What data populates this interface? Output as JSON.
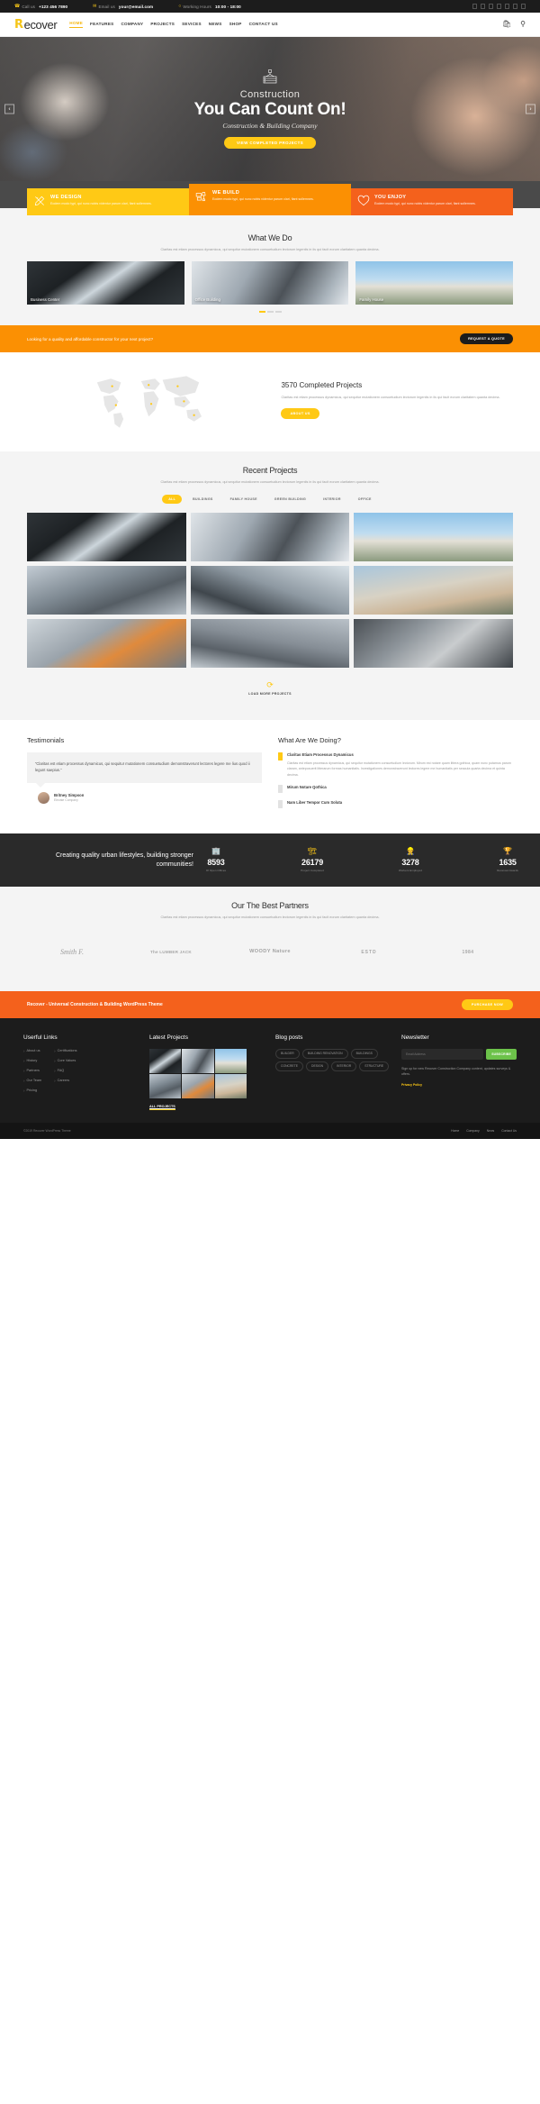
{
  "topbar": {
    "phone_label": "Call us",
    "phone_value": "+123 456 7890",
    "email_label": "Email us",
    "email_value": "your@email.com",
    "hours_label": "Working Hours",
    "hours_value": "10:00 - 18:00",
    "social": [
      "facebook-icon",
      "twitter-icon",
      "linkedin-icon",
      "pinterest-icon",
      "instagram-icon",
      "youtube-icon",
      "rss-icon"
    ]
  },
  "header": {
    "logo_mark": "R",
    "logo_text": "ecover",
    "nav": [
      {
        "label": "HOME",
        "active": true
      },
      {
        "label": "FEATURES",
        "active": false
      },
      {
        "label": "COMPANY",
        "active": false
      },
      {
        "label": "PROJECTS",
        "active": false
      },
      {
        "label": "SEVICES",
        "active": false
      },
      {
        "label": "NEWS",
        "active": false
      },
      {
        "label": "SHOP",
        "active": false
      },
      {
        "label": "CONTACT US",
        "active": false
      }
    ],
    "cart_icon": "cart-icon",
    "search_icon": "search-icon"
  },
  "hero": {
    "icon": "crane-hook-icon",
    "eyebrow": "Construction",
    "headline": "You Can Count On!",
    "subtitle": "Construction & Building Company",
    "button": "VIEW COMPLETED PROJECTS",
    "prev": "‹",
    "next": "›"
  },
  "services": [
    {
      "icon": "pencil-ruler-icon",
      "title": "WE DESIGN",
      "text": "Eodem modo typi, qui nunc nobis videntur parum clari, fiant sollemnes.",
      "color": "#ffc915"
    },
    {
      "icon": "crane-icon",
      "title": "WE BUILD",
      "text": "Eodem modo typi, qui nunc nobis videntur parum clari, fiant sollemnes.",
      "color": "#fb9003"
    },
    {
      "icon": "heart-icon",
      "title": "YOU ENJOY",
      "text": "Eodem modo typi, qui nunc nobis videntur parum clari, fiant sollemnes.",
      "color": "#f4611c"
    }
  ],
  "what_we_do": {
    "title": "What We Do",
    "subtitle": "Claritas est etiam processus dynamicus, qui sequitur mutationem consuetudium lectorum legentis in iis qui facit eorum claritatem quanta decima.",
    "cards": [
      {
        "caption": "Business Center"
      },
      {
        "caption": "Office Building"
      },
      {
        "caption": "Family House"
      }
    ],
    "dots": [
      true,
      false,
      false
    ]
  },
  "quote_bar": {
    "text": "Looking for a quality and affordable constructor for your next project?",
    "button": "REQUEST A QUOTE"
  },
  "completed": {
    "title": "3570 Completed Projects",
    "text": "Claritas est etiam processus dynamicus, qui sequitur mutationem consuetudium lectorum legentis in iis qui facit eorum claritatem quanta decima.",
    "button": "ABOUT US"
  },
  "recent": {
    "title": "Recent Projects",
    "subtitle": "Claritas est etiam processus dynamicus, qui sequitur mutationem consuetudium lectorum legentis in iis qui facit eorum claritatem quanta decima.",
    "filters": [
      {
        "label": "ALL",
        "active": true
      },
      {
        "label": "BUILDINGS",
        "active": false
      },
      {
        "label": "FAMILY HOUSE",
        "active": false
      },
      {
        "label": "GREEN BUILDING",
        "active": false
      },
      {
        "label": "INTERIOR",
        "active": false
      },
      {
        "label": "OFFICE",
        "active": false
      }
    ],
    "load_more_icon": "refresh-icon",
    "load_more": "LOAD MORE PROJECTS"
  },
  "testimonials": {
    "title": "Testimonials",
    "quote": "“Claritas est etiam processus dynamicus, qui sequitur mutationem consuetudium demonstraverunt lectores legere me lius quod ii legunt saepius.”",
    "author_name": "Britney Simpson",
    "author_role": "Elevate Company"
  },
  "accordion": {
    "title": "What Are We Doing?",
    "items": [
      {
        "title": "Claritas Etiam Processus Dynamicus",
        "open": true,
        "text": "Claritas est etiam processus dynamicus, qui sequitur mutationem consuetudium lectorum. Mirum est notare quam littera gothica, quam nunc putamus parum claram, anteposuerit litterarum formas humanitatis. Investigationes demonstraverunt lectores legere me humanitatis per seacula quarta decima et quinta decima."
      },
      {
        "title": "Mirum Notare Qothica",
        "open": false,
        "text": ""
      },
      {
        "title": "Nam Liber Tempor Cum Soluta",
        "open": false,
        "text": ""
      }
    ]
  },
  "stats": {
    "headline": "Creating quality urban lifestyles, building stronger communities!",
    "items": [
      {
        "icon": "building-icon",
        "value": "8593",
        "label": "Of Open Offices"
      },
      {
        "icon": "crane-icon",
        "value": "26179",
        "label": "Project Completed"
      },
      {
        "icon": "worker-icon",
        "value": "3278",
        "label": "Workers Employed"
      },
      {
        "icon": "award-icon",
        "value": "1635",
        "label": "Received Awards"
      }
    ]
  },
  "partners": {
    "title": "Our The Best Partners",
    "subtitle": "Claritas est etiam processus dynamicus, qui sequitur mutationem consuetudium lectorum legentis in iis qui facit eorum claritatem quanta decima.",
    "logos": [
      {
        "text": "Smith F."
      },
      {
        "text": "The LUMBER JACK"
      },
      {
        "text": "WOODY Nature"
      },
      {
        "text": "ESTD"
      },
      {
        "text": "1984"
      }
    ]
  },
  "purchase": {
    "text": "Recover - Universal Construction & Building WordPress Theme",
    "button": "PURCHASE NOW"
  },
  "footer": {
    "useful_links": {
      "title": "Userful Links",
      "col1": [
        "About us",
        "History",
        "Partners",
        "Our Team",
        "Pricing"
      ],
      "col2": [
        "Certifications",
        "Core Values",
        "FAQ",
        "Careers"
      ]
    },
    "latest_projects": {
      "title": "Latest Projects",
      "all_link": "ALL PROJECTS"
    },
    "blog_posts": {
      "title": "Blog posts",
      "tags": [
        "BUILDER",
        "BUILDING RENOVATION",
        "BUILDINGS",
        "CONCRETE",
        "DESIGN",
        "INTERIOR",
        "STRUCTURE"
      ]
    },
    "newsletter": {
      "title": "Newsletter",
      "text": "Sign up for new Recover Construction Company content, updates surveys & offers.",
      "placeholder": "Email Address",
      "button": "SUBSCRIBE",
      "privacy": "Privacy Policy"
    }
  },
  "copyright": {
    "left": "©2019 Recover WordPress Theme",
    "links": [
      "Home",
      "Company",
      "News",
      "Contact Us"
    ]
  }
}
